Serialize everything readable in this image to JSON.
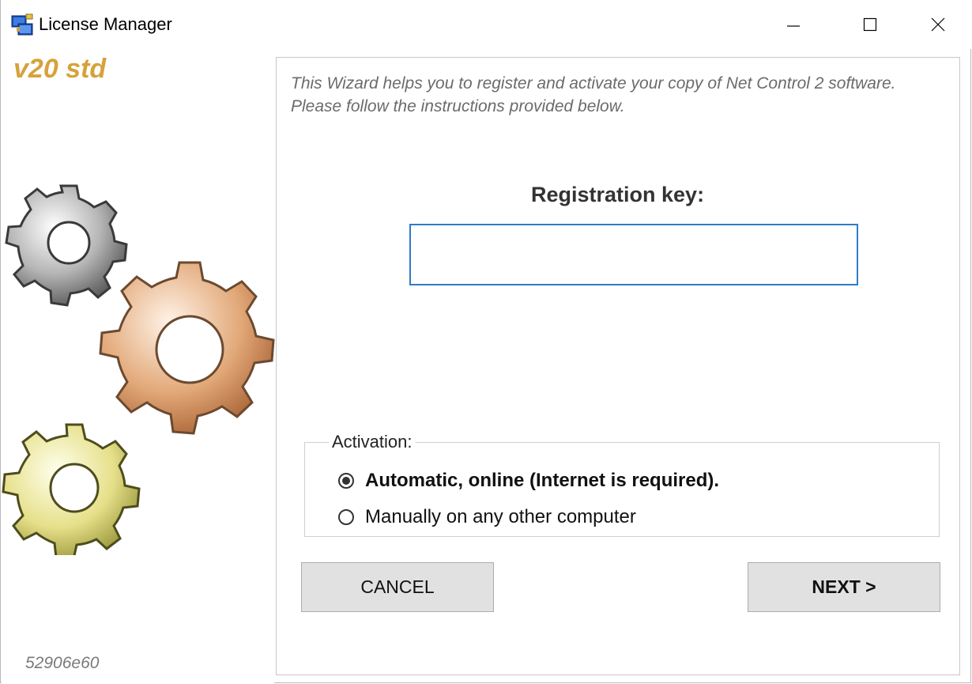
{
  "window": {
    "title": "License Manager"
  },
  "sidebar": {
    "version": "v20 std",
    "hash": "52906e60"
  },
  "panel": {
    "intro_line1": "This Wizard helps you to register and activate your copy of Net Control 2 software.",
    "intro_line2": "Please follow the instructions provided below.",
    "registration_label": "Registration key:",
    "registration_value": "",
    "activation": {
      "legend": "Activation:",
      "options": [
        {
          "label": "Automatic, online (Internet is required).",
          "selected": true
        },
        {
          "label": "Manually on any other computer",
          "selected": false
        }
      ]
    },
    "buttons": {
      "cancel": "CANCEL",
      "next": "NEXT >"
    }
  },
  "colors": {
    "version": "#d6a23a",
    "input_border": "#2f7bc8",
    "button_bg": "#e1e1e1"
  }
}
